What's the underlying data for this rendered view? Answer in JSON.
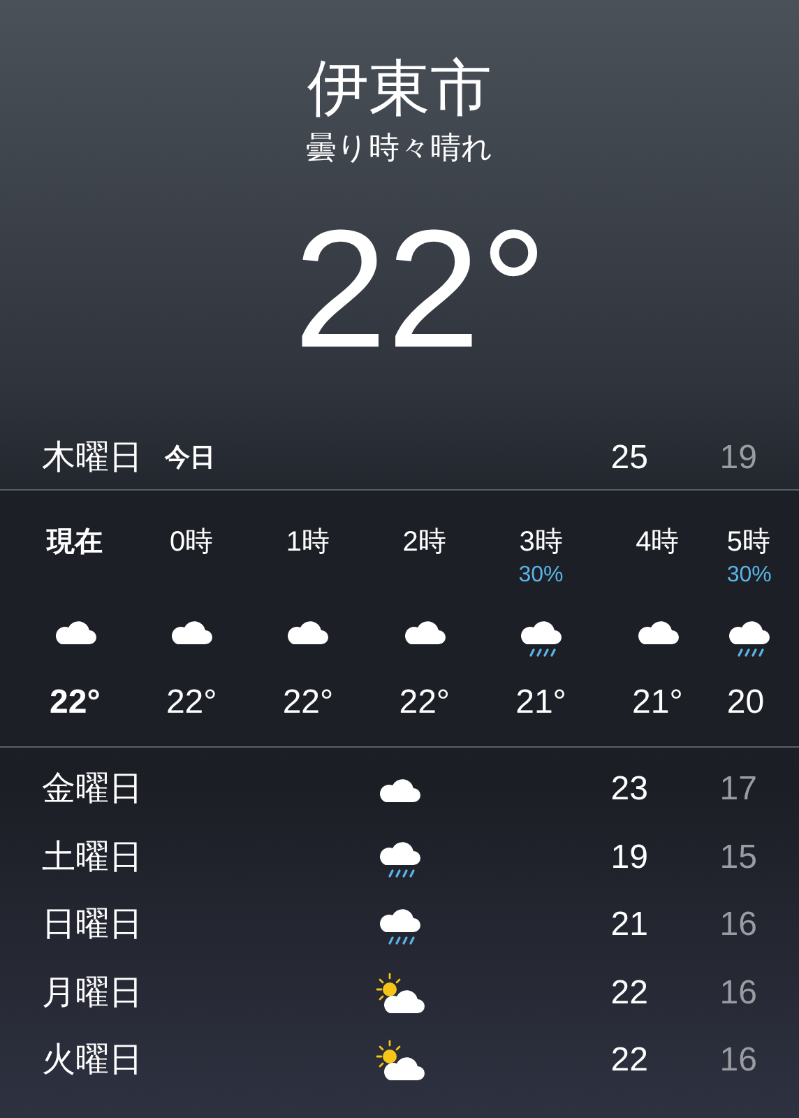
{
  "header": {
    "city": "伊東市",
    "condition": "曇り時々晴れ",
    "temperature": "22°"
  },
  "today": {
    "day": "木曜日",
    "label": "今日",
    "high": "25",
    "low": "19"
  },
  "hourly": [
    {
      "time": "現在",
      "now": true,
      "kind": "cloud",
      "temp": "22°"
    },
    {
      "time": "0時",
      "now": false,
      "kind": "cloud",
      "temp": "22°"
    },
    {
      "time": "1時",
      "now": false,
      "kind": "cloud",
      "temp": "22°"
    },
    {
      "time": "2時",
      "now": false,
      "kind": "cloud",
      "temp": "22°"
    },
    {
      "time": "3時",
      "now": false,
      "kind": "rain",
      "precip": "30%",
      "temp": "21°"
    },
    {
      "time": "4時",
      "now": false,
      "kind": "cloud",
      "temp": "21°"
    },
    {
      "time": "5時",
      "now": false,
      "kind": "rain",
      "precip": "30%",
      "temp": "20"
    }
  ],
  "daily": [
    {
      "day": "金曜日",
      "kind": "cloud",
      "high": "23",
      "low": "17"
    },
    {
      "day": "土曜日",
      "kind": "rain",
      "high": "19",
      "low": "15"
    },
    {
      "day": "日曜日",
      "kind": "rain",
      "high": "21",
      "low": "16"
    },
    {
      "day": "月曜日",
      "kind": "sun",
      "high": "22",
      "low": "16"
    },
    {
      "day": "火曜日",
      "kind": "sun",
      "high": "22",
      "low": "16"
    }
  ]
}
